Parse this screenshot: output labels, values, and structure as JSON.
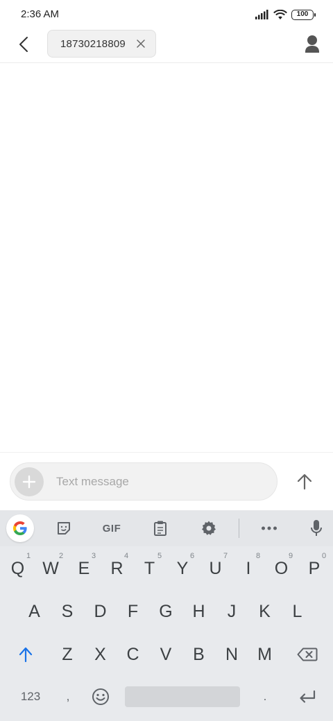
{
  "status_bar": {
    "time": "2:36 AM",
    "battery": "100",
    "icons": [
      "signal-icon",
      "wifi-icon",
      "battery-icon"
    ]
  },
  "header": {
    "recipient": "18730218809",
    "icons": [
      "back-arrow-icon",
      "close-icon",
      "contact-icon"
    ]
  },
  "composer": {
    "placeholder": "Text message",
    "icons": [
      "plus-icon",
      "send-arrow-icon"
    ]
  },
  "keyboard": {
    "toolbar": {
      "gif_label": "GIF",
      "icons": [
        "google-icon",
        "sticker-icon",
        "clipboard-icon",
        "gear-icon",
        "more-icon",
        "mic-icon"
      ]
    },
    "row1": [
      {
        "label": "Q",
        "hint": "1"
      },
      {
        "label": "W",
        "hint": "2"
      },
      {
        "label": "E",
        "hint": "3"
      },
      {
        "label": "R",
        "hint": "4"
      },
      {
        "label": "T",
        "hint": "5"
      },
      {
        "label": "Y",
        "hint": "6"
      },
      {
        "label": "U",
        "hint": "7"
      },
      {
        "label": "I",
        "hint": "8"
      },
      {
        "label": "O",
        "hint": "9"
      },
      {
        "label": "P",
        "hint": "0"
      }
    ],
    "row2": [
      "A",
      "S",
      "D",
      "F",
      "G",
      "H",
      "J",
      "K",
      "L"
    ],
    "row3": [
      "Z",
      "X",
      "C",
      "V",
      "B",
      "N",
      "M"
    ],
    "bottom": {
      "symbols": "123",
      "comma": ",",
      "period": "."
    },
    "colors": {
      "background": "#e8eaed",
      "shift_accent": "#1a73e8"
    }
  }
}
